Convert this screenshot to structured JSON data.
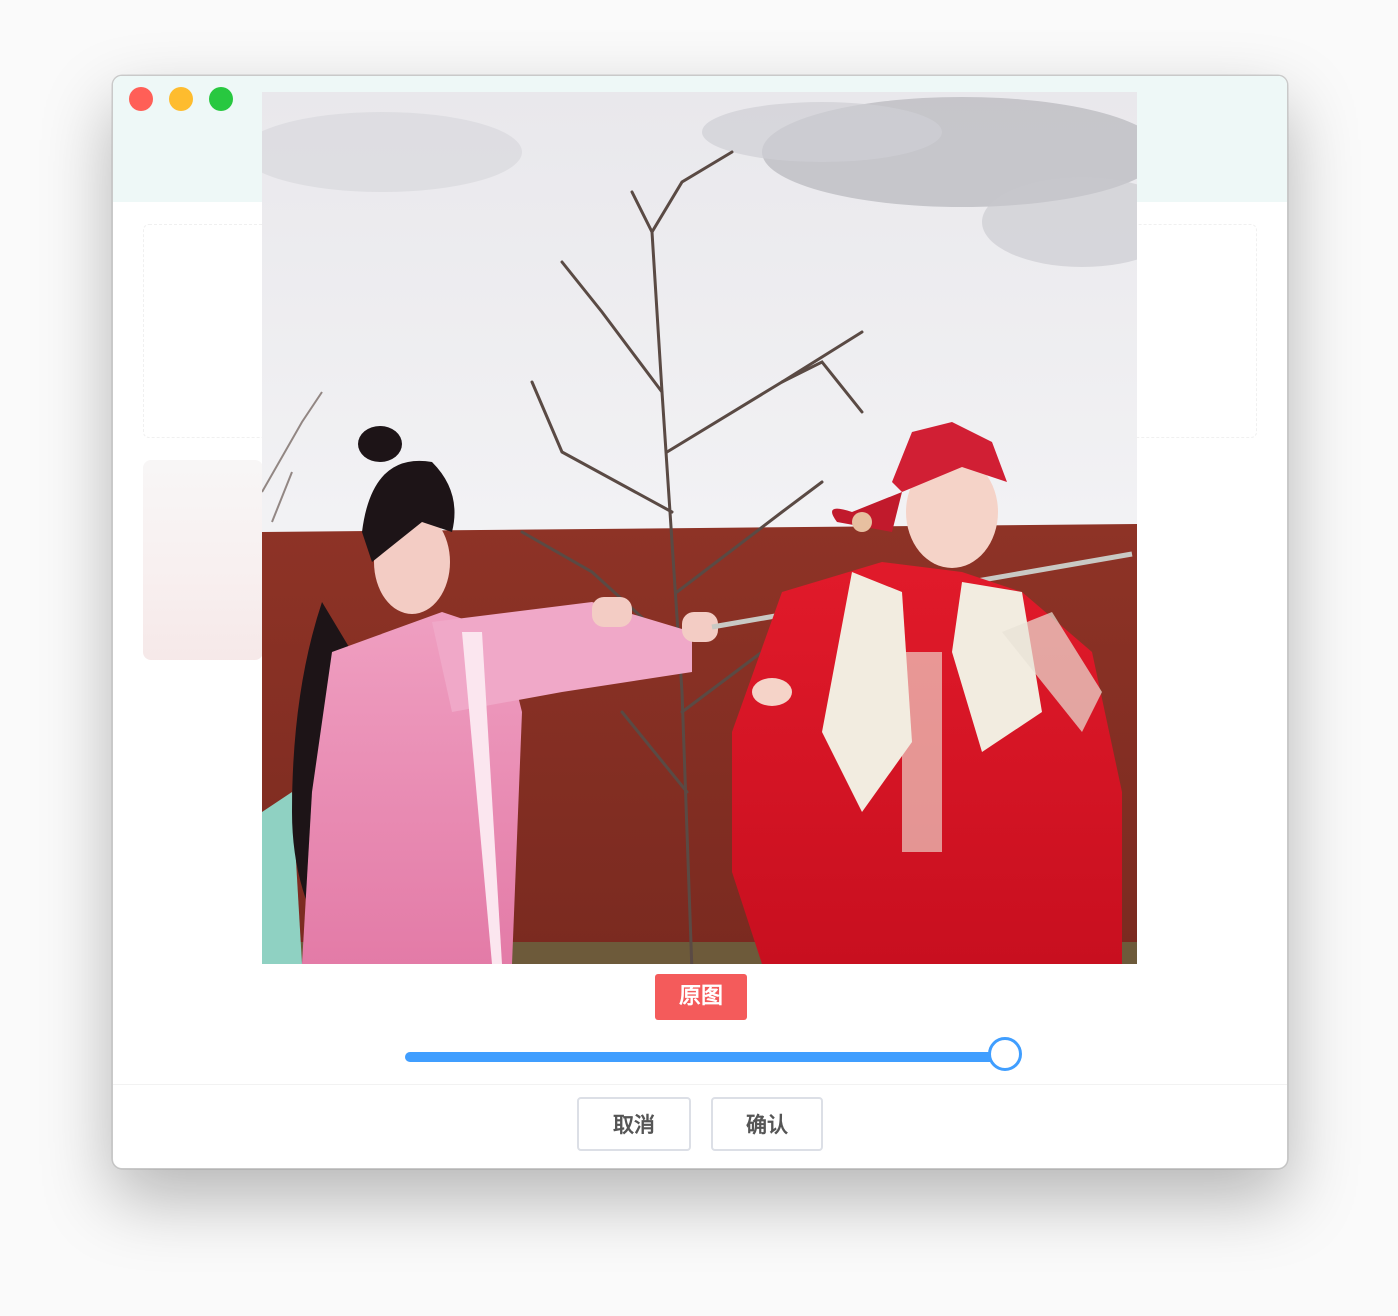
{
  "window": {
    "controls": {
      "close_color": "#ff5f57",
      "minimize_color": "#febc2e",
      "zoom_color": "#28c840"
    }
  },
  "preview": {
    "mode_label": "原图",
    "mode_color": "#f45b5b"
  },
  "slider": {
    "value_fraction": 1.0,
    "accent_color": "#409eff"
  },
  "footer": {
    "cancel_label": "取消",
    "confirm_label": "确认"
  }
}
